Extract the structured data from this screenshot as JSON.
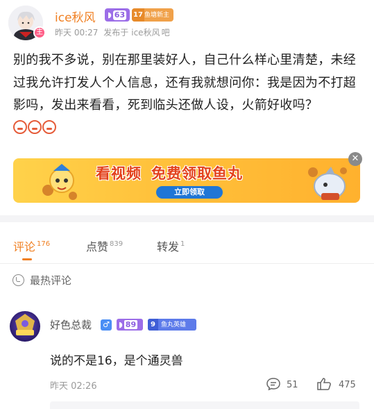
{
  "post": {
    "author": "ice秋风",
    "level": "63",
    "fan_level": "17",
    "fan_badge_text": "鱼塘新主",
    "avatar_badge": "主",
    "time": "昨天 00:27",
    "posted_in_prefix": "发布于",
    "posted_in": "ice秋风",
    "posted_in_suffix": "吧",
    "content": "别的我不多说，别在那里装好人，自己什么样心里清楚，未经过我允许打发人个人信息，还有我就想问你：我是因为不打超影吗，发出来看看，死到临头还做人设，火箭好收吗？",
    "emoji_count": 3
  },
  "banner": {
    "title_left": "看视频",
    "title_right": "免费领取鱼丸",
    "button_label": "立即领取",
    "close_icon": "✕"
  },
  "tabs": [
    {
      "label": "评论",
      "count": "176"
    },
    {
      "label": "点赞",
      "count": "839"
    },
    {
      "label": "转发",
      "count": "1"
    }
  ],
  "hot_comments_label": "最热评论",
  "comment": {
    "user": "好色总裁",
    "gender_symbol": "♂",
    "level": "89",
    "fan_level": "9",
    "fan_badge_text": "鱼丸英雄",
    "text": "说的不是16，是个通灵兽",
    "time": "昨天 02:26",
    "reply_count": "51",
    "like_count": "475"
  },
  "colors": {
    "accent": "#f07f21",
    "level_badge": "#9c6ee8",
    "banner_button": "#1f76d6"
  }
}
